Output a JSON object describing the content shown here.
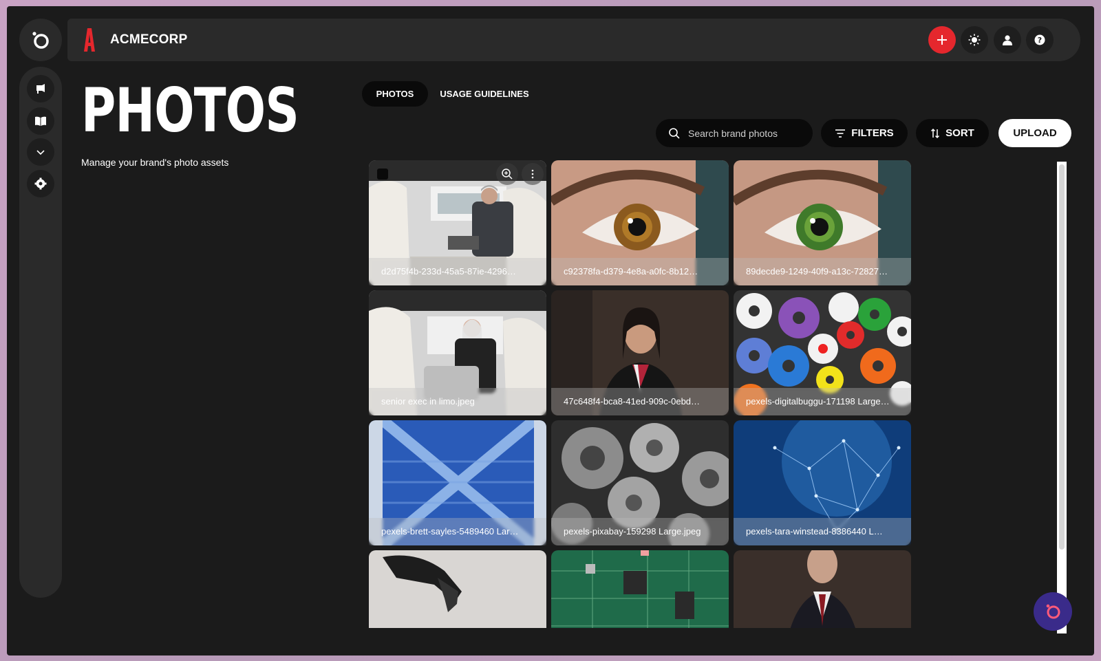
{
  "brand": {
    "name": "ACMECORP"
  },
  "header": {
    "add_label": "+",
    "theme_icon": "sun-icon",
    "user_icon": "user-icon",
    "help_icon": "help-icon"
  },
  "sidebar": {
    "items": [
      {
        "icon": "megaphone-icon"
      },
      {
        "icon": "book-icon"
      },
      {
        "icon": "chevron-down-icon"
      },
      {
        "icon": "gear-icon"
      }
    ]
  },
  "page": {
    "title": "PHOTOS",
    "subtitle": "Manage your brand's photo assets"
  },
  "tabs": [
    {
      "label": "PHOTOS",
      "active": true
    },
    {
      "label": "USAGE GUIDELINES",
      "active": false
    }
  ],
  "toolbar": {
    "search_placeholder": "Search brand photos",
    "filters_label": "FILTERS",
    "sort_label": "SORT",
    "upload_label": "UPLOAD"
  },
  "photos": [
    {
      "name": "d2d75f4b-233d-45a5-87ie-4296…",
      "scene": "businessman in car"
    },
    {
      "name": "c92378fa-d379-4e8a-a0fc-8b12…",
      "scene": "brown eye"
    },
    {
      "name": "89decde9-1249-40f9-a13c-72827…",
      "scene": "green eye"
    },
    {
      "name": "senior exec in limo.jpeg",
      "scene": "woman in car"
    },
    {
      "name": "47c648f4-bca8-41ed-909c-0ebd…",
      "scene": "businesswoman portrait"
    },
    {
      "name": "pexels-digitalbuggu-171198 Large…",
      "scene": "colorful gears"
    },
    {
      "name": "pexels-brett-sayles-5489460 Lar…",
      "scene": "blue server grid"
    },
    {
      "name": "pexels-pixabay-159298 Large.jpeg",
      "scene": "metal gears"
    },
    {
      "name": "pexels-tara-winstead-8386440 L…",
      "scene": "blue network"
    },
    {
      "name": "",
      "scene": "robot hand"
    },
    {
      "name": "",
      "scene": "circuit board"
    },
    {
      "name": "",
      "scene": "man in suit"
    }
  ]
}
